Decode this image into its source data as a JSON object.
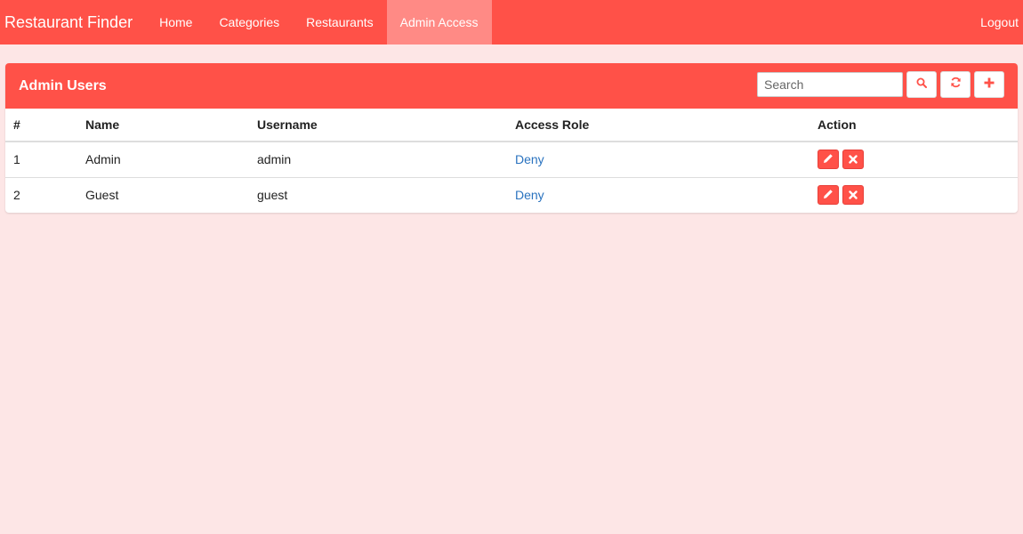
{
  "navbar": {
    "brand": "Restaurant Finder",
    "items": [
      {
        "label": "Home"
      },
      {
        "label": "Categories"
      },
      {
        "label": "Restaurants"
      },
      {
        "label": "Admin Access"
      }
    ],
    "active_item": "Admin Access",
    "logout_label": "Logout"
  },
  "panel": {
    "title": "Admin Users",
    "search": {
      "placeholder": "Search",
      "value": ""
    },
    "tools": {
      "search_icon": "search-icon",
      "refresh_icon": "refresh-icon",
      "add_icon": "plus-icon"
    }
  },
  "table": {
    "headers": [
      "#",
      "Name",
      "Username",
      "Access Role",
      "Action"
    ],
    "rows": [
      {
        "num": "1",
        "name": "Admin",
        "username": "admin",
        "role": "Deny"
      },
      {
        "num": "2",
        "name": "Guest",
        "username": "guest",
        "role": "Deny"
      }
    ],
    "row_actions": {
      "edit_icon": "pencil-icon",
      "delete_icon": "close-icon"
    }
  },
  "colors": {
    "brand": "#ff5148",
    "active_nav": "#ff8a85",
    "background": "#fde6e6",
    "link": "#2a73bf"
  }
}
